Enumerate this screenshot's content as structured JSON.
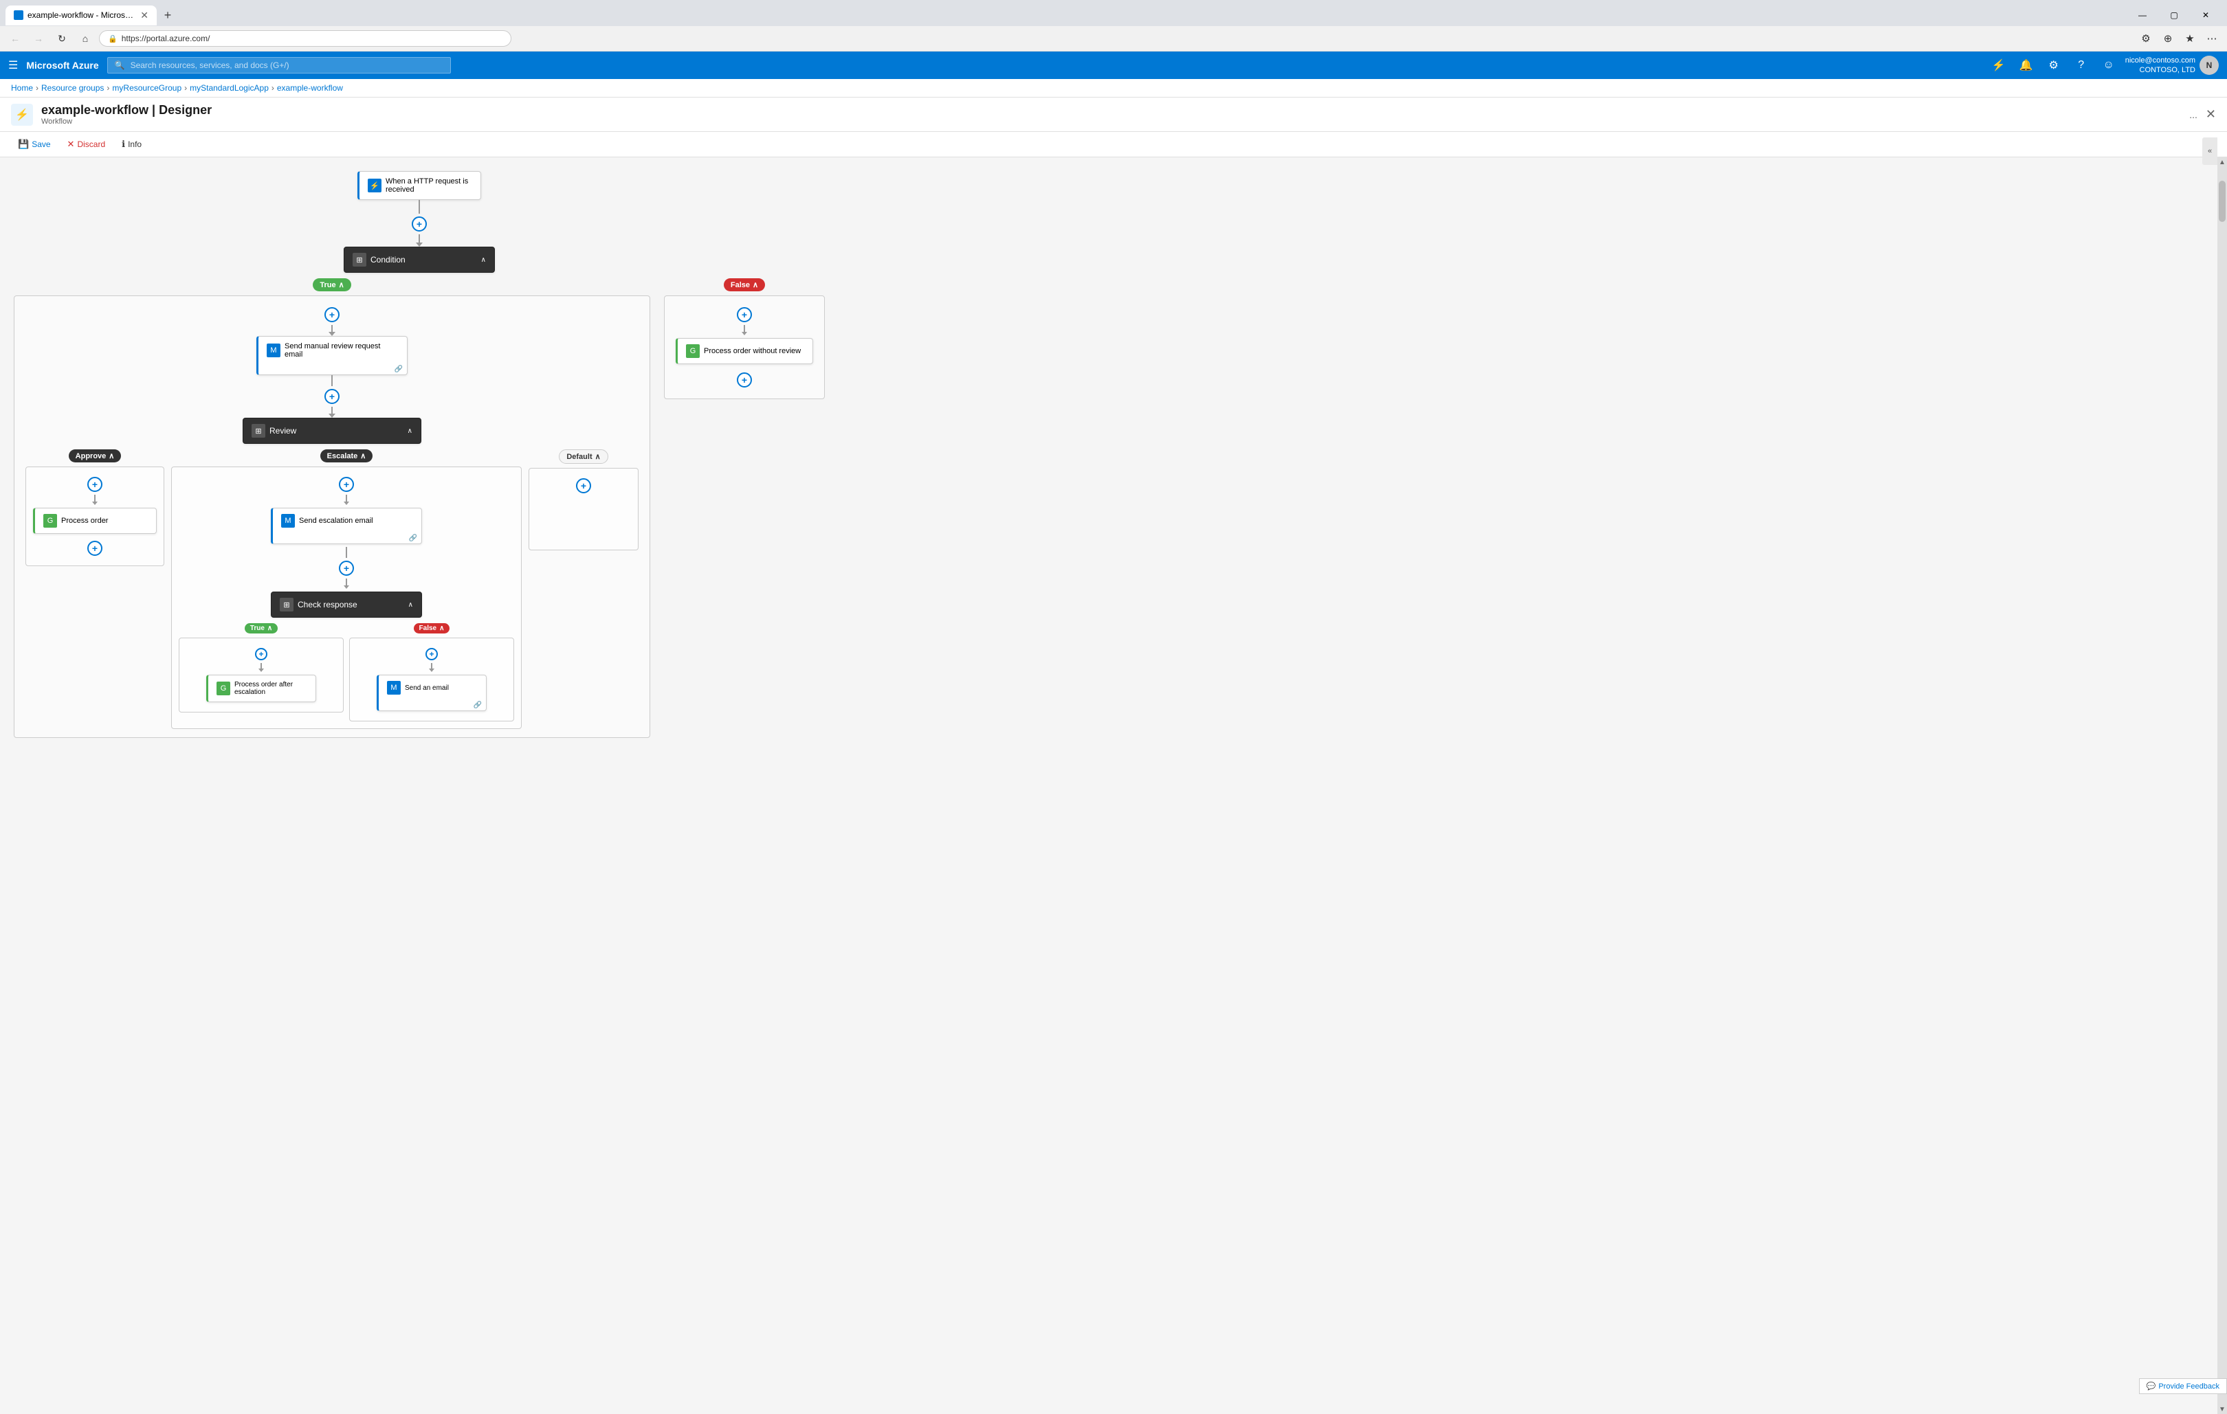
{
  "browser": {
    "tab_title": "example-workflow - Microsoft A...",
    "url": "https://portal.azure.com/",
    "new_tab_label": "+",
    "window_controls": {
      "minimize": "—",
      "maximize": "▢",
      "close": "✕"
    }
  },
  "azure_header": {
    "hamburger": "☰",
    "logo": "Microsoft Azure",
    "search_placeholder": "Search resources, services, and docs (G+/)",
    "user_name": "nicole@contoso.com",
    "user_org": "CONTOSO, LTD"
  },
  "breadcrumb": {
    "home": "Home",
    "resource_groups": "Resource groups",
    "my_resource_group": "myResourceGroup",
    "my_standard_logic_app": "myStandardLogicApp",
    "example_workflow": "example-workflow"
  },
  "page": {
    "title": "example-workflow | Designer",
    "subtitle": "Workflow",
    "close_label": "✕",
    "more_options": "..."
  },
  "toolbar": {
    "save_label": "Save",
    "discard_label": "Discard",
    "info_label": "Info"
  },
  "workflow": {
    "trigger_node": {
      "label": "When a HTTP request is received",
      "icon_type": "blue"
    },
    "condition_node": {
      "label": "Condition",
      "icon_type": "dark"
    },
    "true_branch": {
      "label": "True",
      "send_email_node": {
        "label": "Send manual review request email",
        "icon_type": "blue"
      },
      "review_node": {
        "label": "Review",
        "icon_type": "dark",
        "approve_branch": {
          "label": "Approve",
          "process_order_node": {
            "label": "Process order",
            "icon_type": "green"
          }
        },
        "escalate_branch": {
          "label": "Escalate",
          "send_escalation_node": {
            "label": "Send escalation email",
            "icon_type": "blue"
          },
          "check_response_node": {
            "label": "Check response",
            "icon_type": "dark",
            "true_branch": {
              "label": "True",
              "process_after_escalation_node": {
                "label": "Process order after escalation",
                "icon_type": "green"
              }
            },
            "false_branch": {
              "label": "False",
              "send_email_node": {
                "label": "Send an email",
                "icon_type": "blue"
              }
            }
          }
        },
        "default_branch": {
          "label": "Default"
        }
      }
    },
    "false_branch": {
      "label": "False",
      "process_without_review_node": {
        "label": "Process order without review",
        "icon_type": "green"
      }
    }
  },
  "feedback": {
    "label": "Provide Feedback",
    "icon": "💬"
  },
  "colors": {
    "azure_blue": "#0078d4",
    "true_green": "#4caf50",
    "false_red": "#d32f2f",
    "dark_node": "#323232",
    "canvas_bg": "#f5f5f5"
  }
}
